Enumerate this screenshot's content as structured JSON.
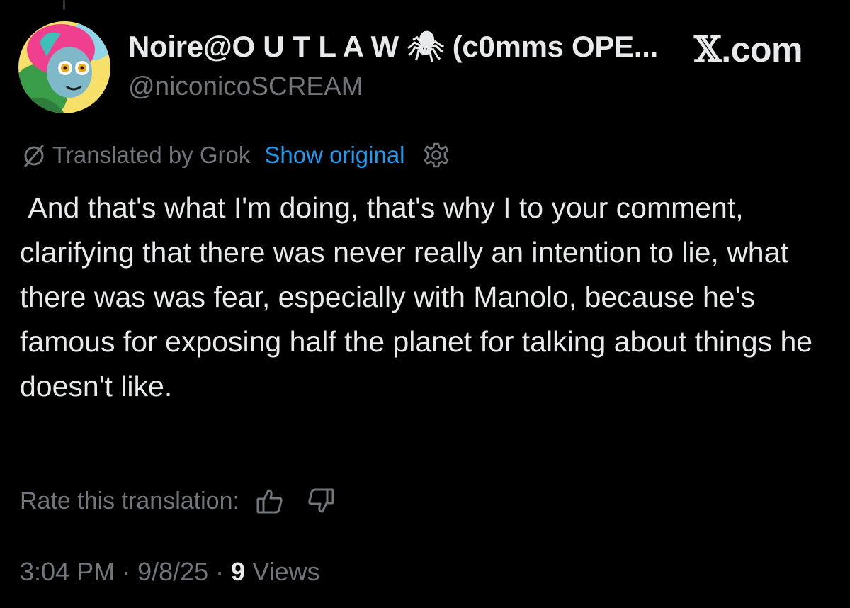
{
  "header": {
    "display_name": "Noire@O U T L A W 🕷 (c0mms OPE...",
    "handle": "@niconicoSCREAM",
    "brand": {
      "mark": "𝕏",
      "suffix": ".com"
    },
    "avatar_icon": "cartoon-avatar"
  },
  "translation": {
    "icon": "grok-slash-icon",
    "label": "Translated by Grok",
    "show_original": "Show original",
    "settings_icon": "gear-icon"
  },
  "tweet": {
    "text": " And that's what I'm doing, that's why I to your comment, clarifying that there was never really an intention to lie, what there was was fear, especially with Manolo, because he's famous for exposing half the planet for talking about things he doesn't like."
  },
  "rate": {
    "label": "Rate this translation:",
    "up_icon": "thumbs-up-icon",
    "down_icon": "thumbs-down-icon"
  },
  "meta": {
    "time": "3:04 PM",
    "sep1": " · ",
    "date": "9/8/25",
    "sep2": " · ",
    "views_count": "9",
    "views_label": " Views"
  },
  "colors": {
    "background": "#000000",
    "text_primary": "#e7e9ea",
    "text_secondary": "#71767b",
    "link": "#1d9bf0"
  }
}
